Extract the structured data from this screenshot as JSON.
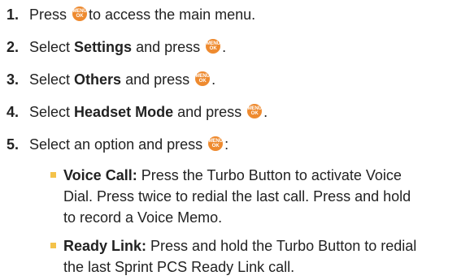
{
  "ok_button": {
    "icon": "menu-ok-button-icon",
    "line1": "MENU",
    "line2": "OK",
    "color": "#ee8a2f"
  },
  "bullet_color": "#f4c24a",
  "steps": [
    {
      "number": "1.",
      "pre": "Press",
      "post": "to access the main menu."
    },
    {
      "number": "2.",
      "pre": "Select",
      "bold": "Settings",
      "mid": "and press",
      "post": "."
    },
    {
      "number": "3.",
      "pre": "Select",
      "bold": "Others",
      "mid": "and press",
      "post": "."
    },
    {
      "number": "4.",
      "pre": "Select",
      "bold": "Headset Mode",
      "mid": "and press",
      "post": "."
    },
    {
      "number": "5.",
      "pre": "Select an option and press",
      "post": ":"
    }
  ],
  "options": [
    {
      "title": "Voice Call:",
      "lines": [
        "Press the Turbo Button to activate Voice",
        "Dial. Press twice to redial the last call. Press and hold",
        "to record a Voice Memo."
      ]
    },
    {
      "title": "Ready Link:",
      "lines": [
        "Press and hold the Turbo Button to redial",
        "the last Sprint PCS Ready Link call."
      ]
    }
  ]
}
